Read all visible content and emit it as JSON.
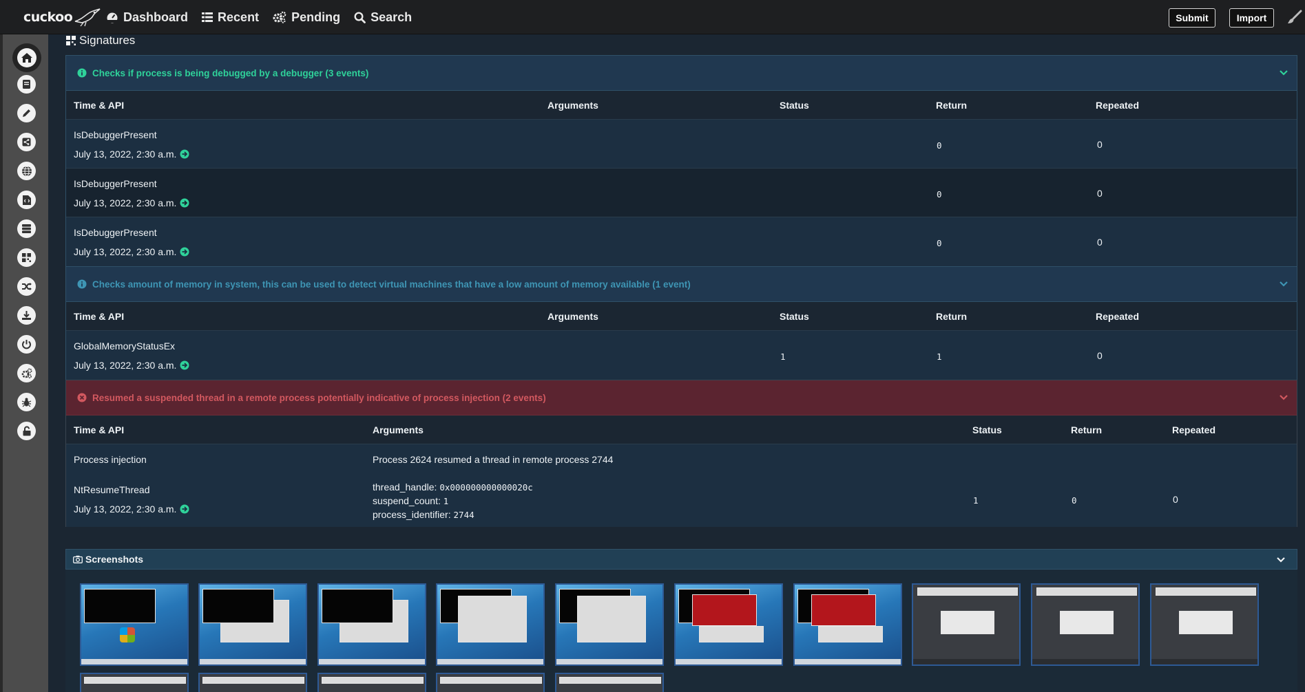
{
  "app": {
    "logo_text": "cuckoo"
  },
  "nav": [
    {
      "label": "Dashboard",
      "icon": "dashboard-icon"
    },
    {
      "label": "Recent",
      "icon": "list-icon"
    },
    {
      "label": "Pending",
      "icon": "cogs-icon"
    },
    {
      "label": "Search",
      "icon": "search-icon"
    }
  ],
  "top_buttons": {
    "submit": "Submit",
    "import": "Import"
  },
  "sidebar": [
    "home-icon",
    "book-icon",
    "pencil-icon",
    "share-icon",
    "globe-icon",
    "file-code-icon",
    "database-icon",
    "qrcode-icon",
    "shuffle-icon",
    "download-icon",
    "power-icon",
    "cogs-icon",
    "bug-icon",
    "unlock-icon"
  ],
  "section_title": "Signatures",
  "signatures": [
    {
      "severity": "info",
      "title": "Checks if process is being debugged by a debugger (3 events)",
      "headers": [
        "Time & API",
        "Arguments",
        "Status",
        "Return",
        "Repeated"
      ],
      "rows": [
        {
          "api": "IsDebuggerPresent",
          "time": "July 13, 2022, 2:30 a.m.",
          "status": "",
          "return": "0",
          "repeated": "0"
        },
        {
          "api": "IsDebuggerPresent",
          "time": "July 13, 2022, 2:30 a.m.",
          "status": "",
          "return": "0",
          "repeated": "0"
        },
        {
          "api": "IsDebuggerPresent",
          "time": "July 13, 2022, 2:30 a.m.",
          "status": "",
          "return": "0",
          "repeated": "0"
        }
      ]
    },
    {
      "severity": "info",
      "title": "Checks amount of memory in system, this can be used to detect virtual machines that have a low amount of memory available (1 event)",
      "headers": [
        "Time & API",
        "Arguments",
        "Status",
        "Return",
        "Repeated"
      ],
      "rows": [
        {
          "api": "GlobalMemoryStatusEx",
          "time": "July 13, 2022, 2:30 a.m.",
          "status": "1",
          "return": "1",
          "repeated": "0"
        }
      ]
    },
    {
      "severity": "danger",
      "title": "Resumed a suspended thread in a remote process potentially indicative of process injection (2 events)",
      "headers": [
        "Time & API",
        "Arguments",
        "Status",
        "Return",
        "Repeated"
      ],
      "rows": [
        {
          "api": "Process injection",
          "arguments": "Process 2624 resumed a thread in remote process 2744"
        },
        {
          "api": "NtResumeThread",
          "time": "July 13, 2022, 2:30 a.m.",
          "args": [
            {
              "key": "thread_handle:",
              "value": "0x000000000000020c"
            },
            {
              "key": "suspend_count:",
              "value": "1"
            },
            {
              "key": "process_identifier:",
              "value": "2744"
            }
          ],
          "status": "1",
          "return": "0",
          "repeated": "0"
        }
      ]
    }
  ],
  "screenshots": {
    "title": "Screenshots"
  },
  "colors": {
    "info_text": "#2fd29a",
    "info_muted": "#3e95b4",
    "danger_bg": "#5b2430",
    "danger_text": "#d2585f",
    "panel_bg": "#203850"
  }
}
